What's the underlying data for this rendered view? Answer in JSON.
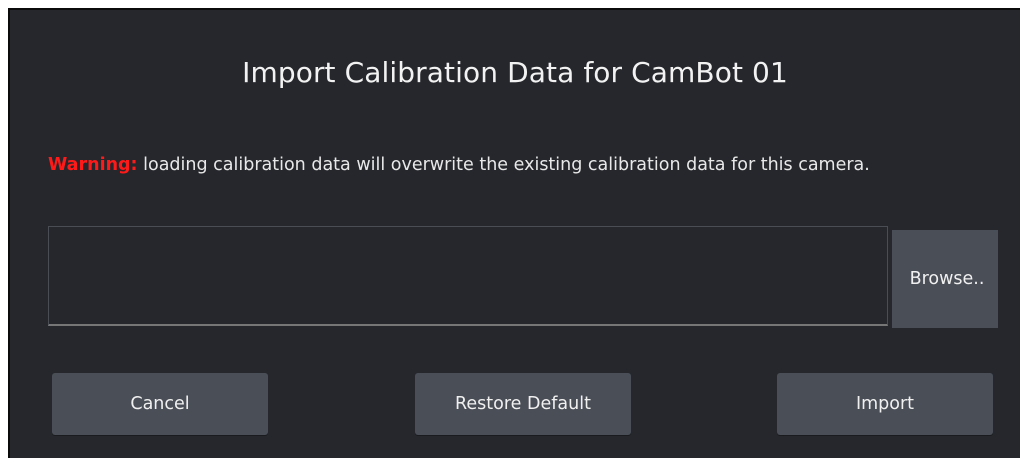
{
  "dialog": {
    "title": "Import Calibration Data for CamBot 01",
    "warning_label": "Warning:",
    "warning_text": " loading calibration data will overwrite the existing calibration data for this camera.",
    "file_path_value": "",
    "browse_label": "Browse..",
    "buttons": {
      "cancel": "Cancel",
      "restore_default": "Restore Default",
      "import": "Import"
    }
  },
  "colors": {
    "background": "#25272c",
    "button": "#4a4e57",
    "warning": "#ff1a1a",
    "text": "#f0f0f0"
  }
}
